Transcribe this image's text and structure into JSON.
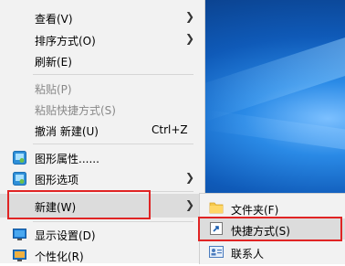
{
  "context_menu": {
    "items": [
      {
        "label": "查看(V)",
        "has_submenu": true
      },
      {
        "label": "排序方式(O)",
        "has_submenu": true
      },
      {
        "label": "刷新(E)"
      },
      {
        "label": "粘贴(P)",
        "disabled": true
      },
      {
        "label": "粘贴快捷方式(S)",
        "disabled": true
      },
      {
        "label": "撤消 新建(U)",
        "shortcut": "Ctrl+Z"
      },
      {
        "label": "图形属性......",
        "icon": "graphics-properties-icon"
      },
      {
        "label": "图形选项",
        "icon": "graphics-options-icon",
        "has_submenu": true
      },
      {
        "label": "新建(W)",
        "has_submenu": true,
        "highlighted": true
      },
      {
        "label": "显示设置(D)",
        "icon": "display-settings-icon"
      },
      {
        "label": "个性化(R)",
        "icon": "personalize-icon"
      }
    ]
  },
  "new_submenu": {
    "items": [
      {
        "label": "文件夹(F)",
        "icon": "folder-icon"
      },
      {
        "label": "快捷方式(S)",
        "icon": "shortcut-icon",
        "highlighted": true
      },
      {
        "label": "联系人",
        "icon": "contact-icon"
      }
    ]
  },
  "colors": {
    "menu_bg": "#f2f2f2",
    "highlight": "#dcdcdc",
    "annotation_red": "#e02424",
    "wallpaper": "#0f5ab8"
  }
}
